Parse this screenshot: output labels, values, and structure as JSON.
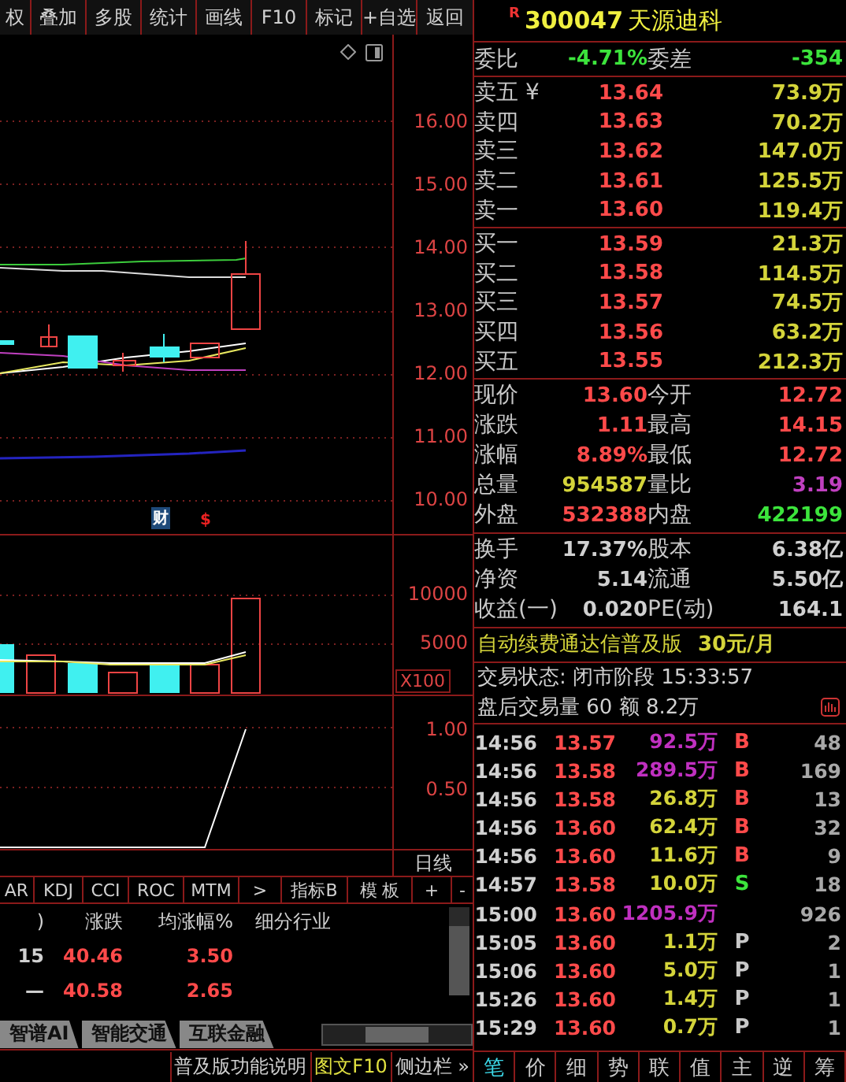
{
  "toolbar": [
    {
      "label": "权"
    },
    {
      "label": "叠加"
    },
    {
      "label": "多股"
    },
    {
      "label": "统计"
    },
    {
      "label": "画线"
    },
    {
      "label": "F10"
    },
    {
      "label": "标记"
    },
    {
      "label": "+自选"
    },
    {
      "label": "返回"
    }
  ],
  "price_axis": [
    "16.00",
    "15.00",
    "14.00",
    "13.00",
    "12.00",
    "11.00",
    "10.00"
  ],
  "chart_markers": [
    {
      "label": "财",
      "kind": "finance"
    },
    {
      "label": "$",
      "kind": "dividend"
    }
  ],
  "volume_axis": [
    "10000",
    "5000"
  ],
  "volume_unit": "X100",
  "indicator_axis": [
    "1.00",
    "0.50"
  ],
  "period": "日线",
  "indicator_tabs": [
    {
      "label": "AR"
    },
    {
      "label": "KDJ"
    },
    {
      "label": "CCI"
    },
    {
      "label": "ROC"
    },
    {
      "label": "MTM"
    },
    {
      "label": ">"
    },
    {
      "label": "指标B"
    },
    {
      "label": "模 板"
    },
    {
      "label": "+"
    },
    {
      "label": "-"
    }
  ],
  "sector_table": {
    "columns": [
      ")",
      "涨跌",
      "均涨幅%",
      "细分行业"
    ],
    "rows": [
      [
        "15",
        "40.46",
        "3.50"
      ],
      [
        "—",
        "40.58",
        "2.65"
      ]
    ]
  },
  "sector_tabs": [
    {
      "label": "智谱AI"
    },
    {
      "label": "智能交通"
    },
    {
      "label": "互联金融"
    }
  ],
  "status_links": [
    {
      "label": "普及版功能说明",
      "highlighted": false
    },
    {
      "label": "图文F10",
      "highlighted": true
    },
    {
      "label": "侧边栏 »",
      "highlighted": false
    }
  ],
  "stock": {
    "badge": "R",
    "code": "300047",
    "name": "天源迪科"
  },
  "order_ratio": [
    {
      "label": "委比",
      "value": "-4.71%",
      "color": "#3ce43c"
    },
    {
      "label": "委差",
      "value": "-354",
      "color": "#3ce43c"
    }
  ],
  "asks": [
    {
      "label": "卖五",
      "marker": "¥",
      "price": "13.64",
      "volume": "73.9万"
    },
    {
      "label": "卖四",
      "price": "13.63",
      "volume": "70.2万"
    },
    {
      "label": "卖三",
      "price": "13.62",
      "volume": "147.0万"
    },
    {
      "label": "卖二",
      "price": "13.61",
      "volume": "125.5万"
    },
    {
      "label": "卖一",
      "price": "13.60",
      "volume": "119.4万"
    }
  ],
  "bids": [
    {
      "label": "买一",
      "price": "13.59",
      "volume": "21.3万"
    },
    {
      "label": "买二",
      "price": "13.58",
      "volume": "114.5万"
    },
    {
      "label": "买三",
      "price": "13.57",
      "volume": "74.5万"
    },
    {
      "label": "买四",
      "price": "13.56",
      "volume": "63.2万"
    },
    {
      "label": "买五",
      "price": "13.55",
      "volume": "212.3万"
    }
  ],
  "quote": [
    [
      {
        "label": "现价",
        "value": "13.60",
        "color": "#ff4a4a"
      },
      {
        "label": "今开",
        "value": "12.72",
        "color": "#ff4a4a"
      }
    ],
    [
      {
        "label": "涨跌",
        "value": "1.11",
        "color": "#ff4a4a"
      },
      {
        "label": "最高",
        "value": "14.15",
        "color": "#ff4a4a"
      }
    ],
    [
      {
        "label": "涨幅",
        "value": "8.89%",
        "color": "#ff4a4a"
      },
      {
        "label": "最低",
        "value": "12.72",
        "color": "#ff4a4a"
      }
    ],
    [
      {
        "label": "总量",
        "value": "954587",
        "color": "#d4d43a"
      },
      {
        "label": "量比",
        "value": "3.19",
        "color": "#c040c0"
      }
    ],
    [
      {
        "label": "外盘",
        "value": "532388",
        "color": "#ff4a4a"
      },
      {
        "label": "内盘",
        "value": "422199",
        "color": "#3ce43c"
      }
    ]
  ],
  "fundamentals": [
    [
      {
        "label": "换手",
        "value": "17.37%"
      },
      {
        "label": "股本",
        "value": "6.38亿"
      }
    ],
    [
      {
        "label": "净资",
        "value": "5.14"
      },
      {
        "label": "流通",
        "value": "5.50亿"
      }
    ],
    [
      {
        "label": "收益(一)",
        "value": "0.020"
      },
      {
        "label": "PE(动)",
        "value": "164.1"
      }
    ]
  ],
  "promo": {
    "text": "自动续费通达信普及版",
    "price": "30元/月"
  },
  "trade_status": "交易状态: 闭市阶段 15:33:57",
  "after_hours": "盘后交易量 60 额 8.2万",
  "trades": [
    {
      "time": "14:56",
      "price": "13.57",
      "volume": "92.5万",
      "large": true,
      "side": "B",
      "count": "48"
    },
    {
      "time": "14:56",
      "price": "13.58",
      "volume": "289.5万",
      "large": true,
      "side": "B",
      "count": "169"
    },
    {
      "time": "14:56",
      "price": "13.58",
      "volume": "26.8万",
      "large": false,
      "side": "B",
      "count": "13"
    },
    {
      "time": "14:56",
      "price": "13.60",
      "volume": "62.4万",
      "large": false,
      "side": "B",
      "count": "32"
    },
    {
      "time": "14:56",
      "price": "13.60",
      "volume": "11.6万",
      "large": false,
      "side": "B",
      "count": "9"
    },
    {
      "time": "14:57",
      "price": "13.58",
      "volume": "10.0万",
      "large": false,
      "side": "S",
      "count": "18"
    },
    {
      "time": "15:00",
      "price": "13.60",
      "volume": "1205.9万",
      "large": true,
      "count": "926"
    },
    {
      "time": "15:05",
      "price": "13.60",
      "volume": "1.1万",
      "large": false,
      "side": "P",
      "count": "2"
    },
    {
      "time": "15:06",
      "price": "13.60",
      "volume": "5.0万",
      "large": false,
      "side": "P",
      "count": "1"
    },
    {
      "time": "15:26",
      "price": "13.60",
      "volume": "1.4万",
      "large": false,
      "side": "P",
      "count": "1"
    },
    {
      "time": "15:29",
      "price": "13.60",
      "volume": "0.7万",
      "large": false,
      "side": "P",
      "count": "1"
    }
  ],
  "detail_tabs": [
    {
      "label": "笔",
      "selected": true
    },
    {
      "label": "价",
      "selected": false
    },
    {
      "label": "细",
      "selected": false
    },
    {
      "label": "势",
      "selected": false
    },
    {
      "label": "联",
      "selected": false
    },
    {
      "label": "值",
      "selected": false
    },
    {
      "label": "主",
      "selected": false
    },
    {
      "label": "逆",
      "selected": false
    },
    {
      "label": "筹",
      "selected": false
    }
  ]
}
